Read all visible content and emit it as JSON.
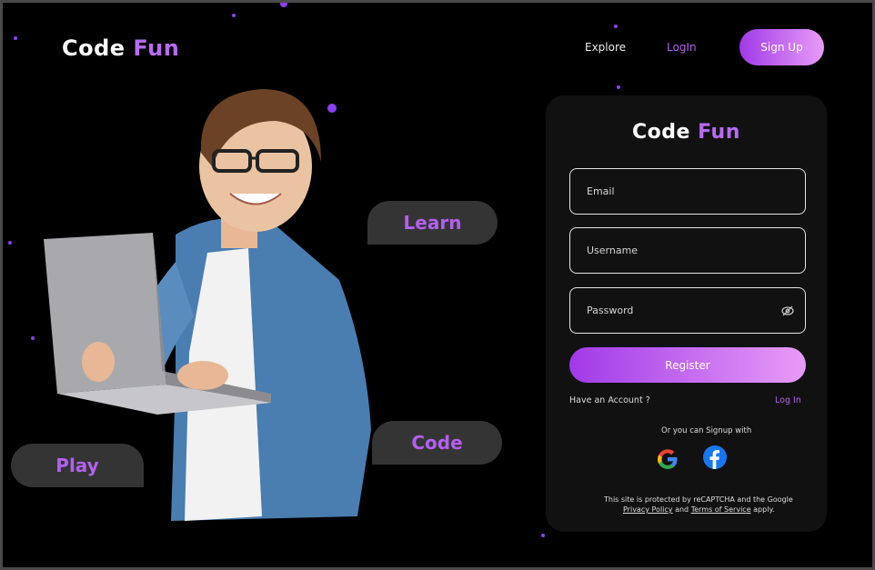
{
  "brand": {
    "part1": "Code",
    "part2": "Fun"
  },
  "nav": {
    "explore": "Explore",
    "login": "LogIn",
    "signup": "Sign Up"
  },
  "bubbles": {
    "learn": "Learn",
    "code": "Code",
    "play": "Play"
  },
  "form": {
    "title_part1": "Code",
    "title_part2": "Fun",
    "email_placeholder": "Email",
    "username_placeholder": "Username",
    "password_placeholder": "Password",
    "register_label": "Register",
    "have_account": "Have an Account ?",
    "login_link": "Log In",
    "signup_with": "Or you can Signup with",
    "recaptcha_line": "This site is protected by reCAPTCHA and the Google",
    "privacy_policy": "Privacy Policy",
    "and": "and",
    "terms": "Terms of Service",
    "apply": "apply."
  },
  "colors": {
    "accent": "#b66cf0",
    "gradient_start": "#a13ae8",
    "gradient_end": "#e79cf7",
    "background": "#000000",
    "card": "#111111"
  },
  "icons": {
    "google": "google-icon",
    "facebook": "facebook-icon",
    "eye_off": "eye-off-icon"
  }
}
